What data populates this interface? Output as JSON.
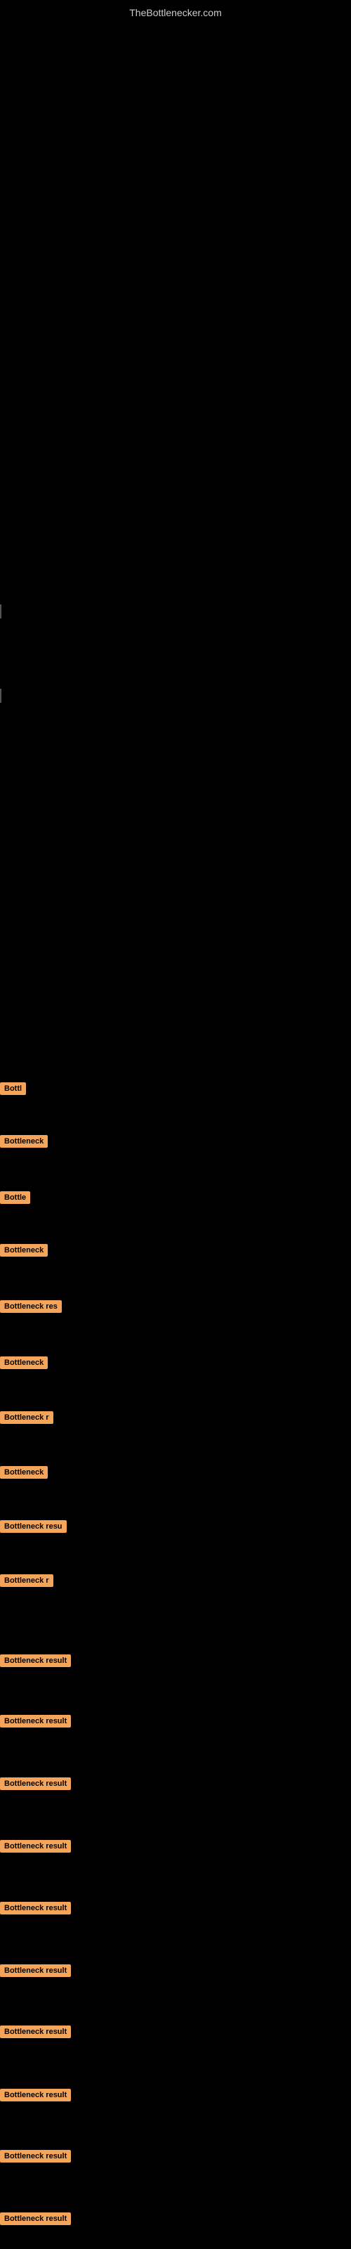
{
  "site": {
    "title": "TheBottlenecker.com"
  },
  "badges": [
    {
      "id": 1,
      "label": "Bottl",
      "class": "badge-1"
    },
    {
      "id": 2,
      "label": "Bottleneck",
      "class": "badge-2"
    },
    {
      "id": 3,
      "label": "Bottle",
      "class": "badge-3"
    },
    {
      "id": 4,
      "label": "Bottleneck",
      "class": "badge-4"
    },
    {
      "id": 5,
      "label": "Bottleneck res",
      "class": "badge-5"
    },
    {
      "id": 6,
      "label": "Bottleneck",
      "class": "badge-6"
    },
    {
      "id": 7,
      "label": "Bottleneck r",
      "class": "badge-7"
    },
    {
      "id": 8,
      "label": "Bottleneck",
      "class": "badge-8"
    },
    {
      "id": 9,
      "label": "Bottleneck resu",
      "class": "badge-9"
    },
    {
      "id": 10,
      "label": "Bottleneck r",
      "class": "badge-10"
    },
    {
      "id": 11,
      "label": "Bottleneck result",
      "class": "badge-11"
    },
    {
      "id": 12,
      "label": "Bottleneck result",
      "class": "badge-12"
    },
    {
      "id": 13,
      "label": "Bottleneck result",
      "class": "badge-13"
    },
    {
      "id": 14,
      "label": "Bottleneck result",
      "class": "badge-14"
    },
    {
      "id": 15,
      "label": "Bottleneck result",
      "class": "badge-15"
    },
    {
      "id": 16,
      "label": "Bottleneck result",
      "class": "badge-16"
    },
    {
      "id": 17,
      "label": "Bottleneck result",
      "class": "badge-17"
    },
    {
      "id": 18,
      "label": "Bottleneck result",
      "class": "badge-18"
    },
    {
      "id": 19,
      "label": "Bottleneck result",
      "class": "badge-19"
    },
    {
      "id": 20,
      "label": "Bottleneck result",
      "class": "badge-20"
    }
  ]
}
